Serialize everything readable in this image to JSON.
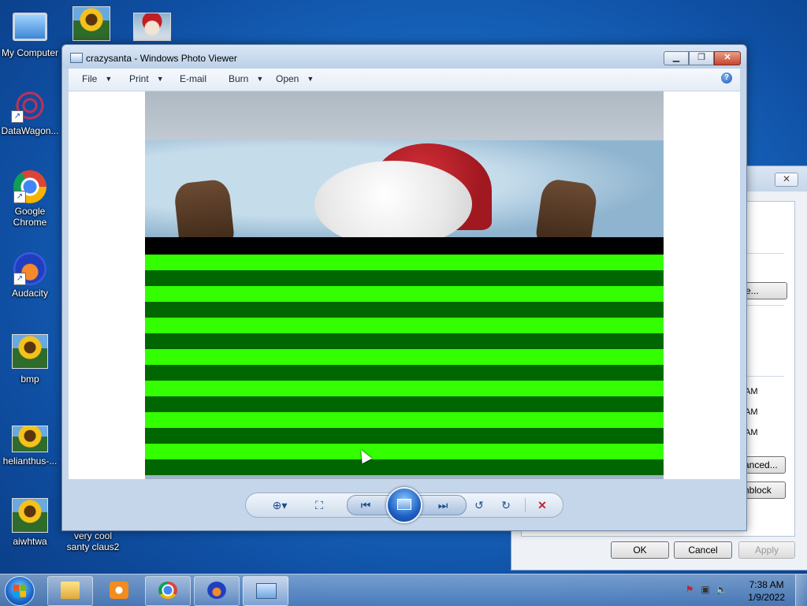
{
  "desktop": {
    "icons": [
      {
        "label": "My Computer"
      },
      {
        "label": "DataWagon..."
      },
      {
        "label": "Google Chrome"
      },
      {
        "label": "Audacity"
      },
      {
        "label": "bmp"
      },
      {
        "label": "helianthus-..."
      },
      {
        "label": "aiwhtwa"
      },
      {
        "label": "very cool santy claus2"
      }
    ]
  },
  "viewer": {
    "title": "crazysanta - Windows Photo Viewer",
    "menu": [
      {
        "label": "File"
      },
      {
        "label": "Print"
      },
      {
        "label": "E-mail"
      },
      {
        "label": "Burn"
      },
      {
        "label": "Open"
      }
    ],
    "help_glyph": "?",
    "image_colors": {
      "light_green": "#33ff00",
      "dark_green": "#006600"
    }
  },
  "bg_dialog": {
    "partial_texts": {
      "btn1": "e...",
      "am1": "AM",
      "am2": "AM",
      "am3": "AM",
      "advanced": "anced...",
      "unblock": "nblock"
    },
    "buttons": {
      "ok": "OK",
      "cancel": "Cancel",
      "apply": "Apply"
    }
  },
  "taskbar": {
    "clock_time": "7:38 AM",
    "clock_date": "1/9/2022"
  }
}
